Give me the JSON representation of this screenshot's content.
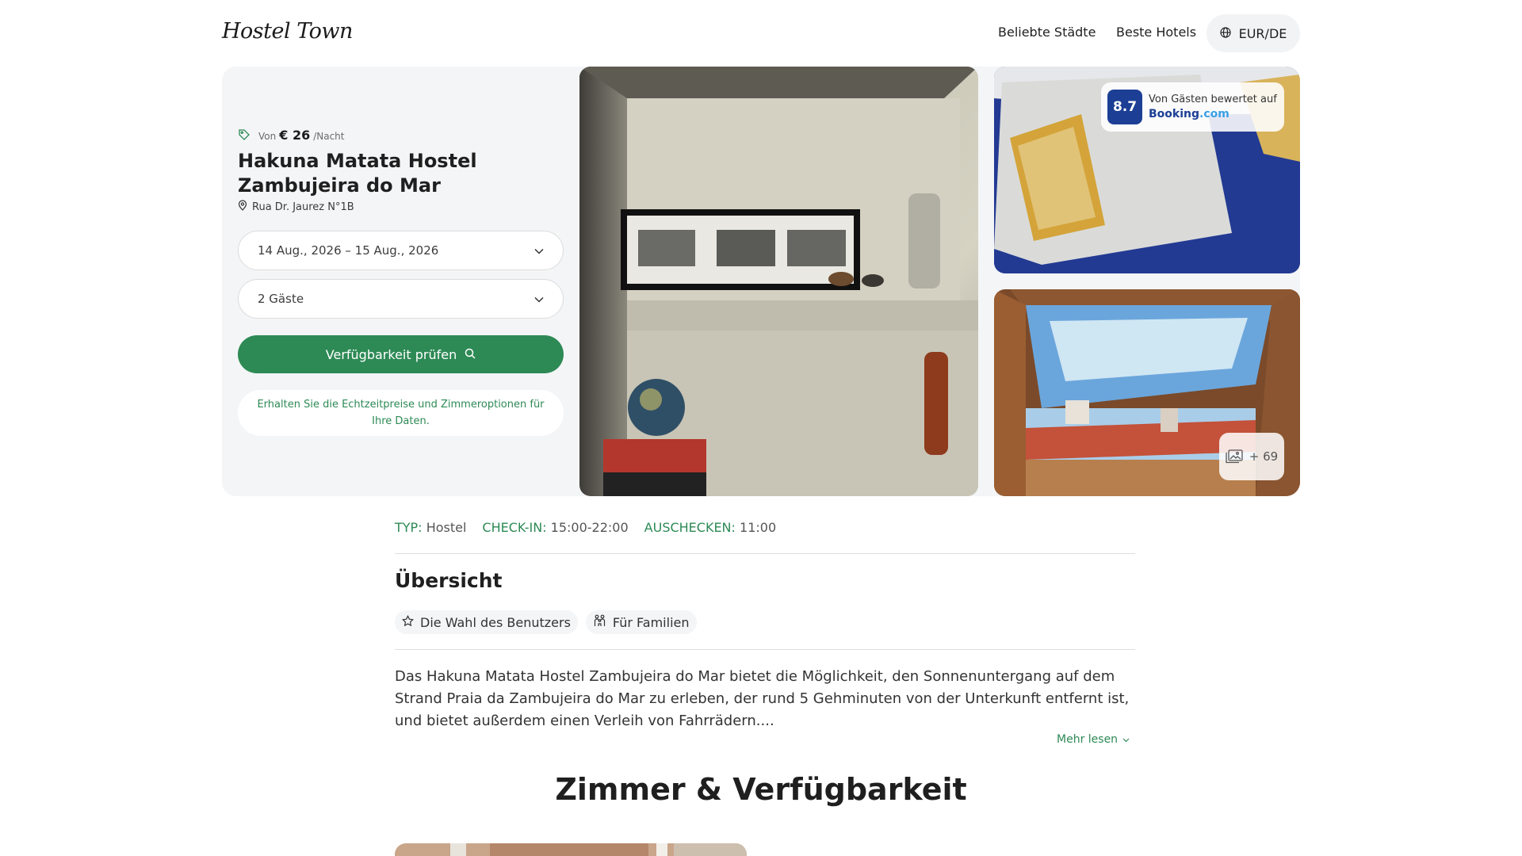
{
  "header": {
    "logo": "Hostel Town",
    "nav": {
      "cities": "Beliebte Städte",
      "hotels": "Beste Hotels"
    },
    "currency": "EUR/DE"
  },
  "booking": {
    "price_prefix": "Von",
    "price": "€ 26",
    "price_suffix": "/Nacht",
    "hotel_name": "Hakuna Matata Hostel Zambujeira do Mar",
    "address": "Rua Dr. Jaurez N°1B",
    "dates": "14 Aug., 2026 – 15 Aug., 2026",
    "guests": "2 Gäste",
    "check_button": "Verfügbarkeit prüfen",
    "notice": "Erhalten Sie die Echtzeitpreise und Zimmeroptionen für Ihre Daten."
  },
  "rating": {
    "score": "8.7",
    "label": "Von Gästen bewertet auf",
    "brand": "Booking",
    "brand_suffix": ".com"
  },
  "gallery": {
    "more_count": "+ 69"
  },
  "info": {
    "type_key": "TYP:",
    "type_val": "Hostel",
    "checkin_key": "CHECK-IN:",
    "checkin_val": "15:00-22:00",
    "checkout_key": "AUSCHECKEN:",
    "checkout_val": "11:00"
  },
  "overview": {
    "title": "Übersicht",
    "chips": [
      "Die Wahl des Benutzers",
      "Für Familien"
    ],
    "description": "Das Hakuna Matata Hostel Zambujeira do Mar bietet die Möglichkeit, den Sonnenuntergang auf dem Strand Praia da Zambujeira do Mar zu erleben, der rund 5 Gehminuten von der Unterkunft entfernt ist, und bietet außerdem einen Verleih von Fahrrädern....",
    "read_more": "Mehr lesen"
  },
  "rooms": {
    "title": "Zimmer & Verfügbarkeit"
  },
  "colors": {
    "accent": "#2d8a55",
    "booking_blue": "#1c3f95",
    "panel_bg": "#f4f5f7"
  }
}
